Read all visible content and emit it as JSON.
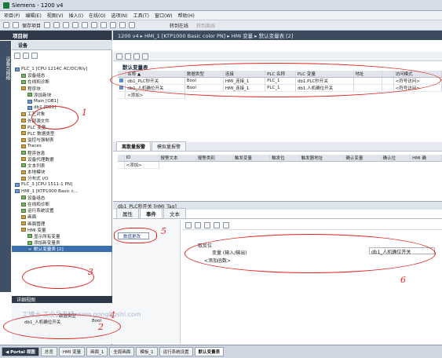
{
  "window": {
    "title": "Siemens - 1200 v4"
  },
  "menu": [
    "项目(P)",
    "编辑(E)",
    "视图(V)",
    "插入(I)",
    "在线(O)",
    "选项(N)",
    "工具(T)",
    "窗口(W)",
    "帮助(H)"
  ],
  "toolbar": {
    "save": "保存项目",
    "online": "转到在线",
    "offline": "转到离线"
  },
  "left_panel": {
    "title": "项目树",
    "tab": "设备",
    "tree": [
      {
        "label": "PLC_1 [CPU 1214C AC/DC/Rly]",
        "lvl": 1,
        "ic": "b"
      },
      {
        "label": "设备组态",
        "lvl": 2,
        "ic": "g"
      },
      {
        "label": "在线和诊断",
        "lvl": 2,
        "ic": "g"
      },
      {
        "label": "程序块",
        "lvl": 2,
        "ic": "y"
      },
      {
        "label": "添加新块",
        "lvl": 3,
        "ic": "g"
      },
      {
        "label": "Main [OB1]",
        "lvl": 3,
        "ic": "b"
      },
      {
        "label": "db1 [DB1]",
        "lvl": 3,
        "ic": "b"
      },
      {
        "label": "工艺对象",
        "lvl": 2,
        "ic": "y"
      },
      {
        "label": "外部源文件",
        "lvl": 2,
        "ic": "y"
      },
      {
        "label": "PLC 变量",
        "lvl": 2,
        "ic": "y"
      },
      {
        "label": "PLC 数据类型",
        "lvl": 2,
        "ic": "y"
      },
      {
        "label": "监控与强制表",
        "lvl": 2,
        "ic": "y"
      },
      {
        "label": "Traces",
        "lvl": 2,
        "ic": "y"
      },
      {
        "label": "程序信息",
        "lvl": 2,
        "ic": "g"
      },
      {
        "label": "设备代理数据",
        "lvl": 2,
        "ic": "y"
      },
      {
        "label": "文本列表",
        "lvl": 2,
        "ic": "g"
      },
      {
        "label": "本地模块",
        "lvl": 2,
        "ic": "y"
      },
      {
        "label": "分布式 I/O",
        "lvl": 2,
        "ic": "y"
      },
      {
        "label": "PLC_3 [CPU 1511-1 PN]",
        "lvl": 1,
        "ic": "b"
      },
      {
        "label": "HMI_1 [KTP1000 Basic c...",
        "lvl": 1,
        "ic": "b"
      },
      {
        "label": "设备组态",
        "lvl": 2,
        "ic": "g"
      },
      {
        "label": "在线和诊断",
        "lvl": 2,
        "ic": "g"
      },
      {
        "label": "运行系统设置",
        "lvl": 2,
        "ic": "g"
      },
      {
        "label": "画面",
        "lvl": 2,
        "ic": "y"
      },
      {
        "label": "画面管理",
        "lvl": 2,
        "ic": "y"
      },
      {
        "label": "HMI 变量",
        "lvl": 2,
        "ic": "y"
      },
      {
        "label": "显示所有变量",
        "lvl": 3,
        "ic": "g"
      },
      {
        "label": "添加新变量表",
        "lvl": 3,
        "ic": "g"
      },
      {
        "label": "默认变量表 [2]",
        "lvl": 3,
        "ic": "b",
        "sel": true
      }
    ],
    "details_title": "详细视图",
    "details_col": "数据类型",
    "details_row_name": "db1_人机确位开关",
    "details_row_type": "Bool"
  },
  "editor": {
    "breadcrumb": "1200 v4 ▸ HMI_1 [KTP1000 Basic color PN] ▸ HMI 变量 ▸ 默认变量表 [2]",
    "section": "默认变量表",
    "columns": [
      "名称 ▲",
      "数据类型",
      "连接",
      "PLC 名称",
      "PLC 变量",
      "地址",
      "",
      "访问模式"
    ],
    "rows": [
      [
        "db1_PLC秒开关",
        "Bool",
        "HMI_连接_1",
        "PLC_1",
        "db1.PLC秒开关",
        "",
        "",
        "<符号访问>"
      ],
      [
        "db1_人机确位开关",
        "Bool",
        "HMI_连接_1",
        "PLC_1",
        "db1.人机确位开关",
        "",
        "",
        "<符号访问>"
      ]
    ],
    "add_row": "<添加>"
  },
  "alarms": {
    "tabs": [
      "离散量报警",
      "模拟量报警"
    ],
    "columns": [
      "ID",
      "报警文本",
      "报警类别",
      "触发变量",
      "触发位",
      "触发器地址",
      "确认变量",
      "确认位",
      "HMI 确"
    ],
    "add_row": "<添加>"
  },
  "properties": {
    "title": "db1_PLC秒开关 [HMI_Tag]",
    "tabs": [
      "属性",
      "事件",
      "文本"
    ],
    "event_button": "数值更改",
    "function_label": "取反位",
    "param_label": "变量 (输入/输出)",
    "param_value": "db1_人机确位开关",
    "add_function": "<添加函数>"
  },
  "statusbar": {
    "portal": "Portal 视图",
    "items": [
      "总览",
      "HMI 变量",
      "画面_1",
      "全局画面",
      "模板_1",
      "运行系统设置",
      "默认变量表"
    ]
  },
  "annotations": [
    "1",
    "2",
    "3",
    "4",
    "5",
    "6"
  ],
  "watermark": "工博士 工业品商城 www.gongboshi.com"
}
